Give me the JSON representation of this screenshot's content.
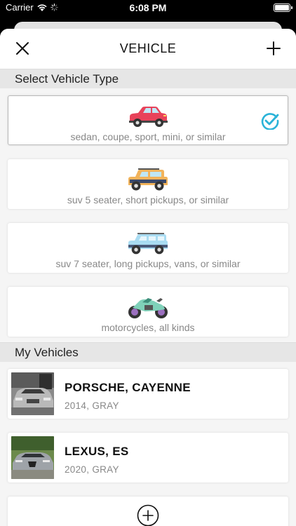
{
  "status": {
    "carrier": "Carrier",
    "time": "6:08 PM"
  },
  "nav": {
    "title": "VEHICLE",
    "close_icon": "close-icon",
    "add_icon": "plus-icon"
  },
  "select_type": {
    "header": "Select Vehicle Type",
    "types": [
      {
        "label": "sedan, coupe, sport, mini, or similar",
        "icon": "sedan-icon",
        "color": "#e8425a",
        "selected": true
      },
      {
        "label": "suv 5 seater, short pickups, or similar",
        "icon": "suv-5-seater-icon",
        "color": "#f2b35a",
        "selected": false
      },
      {
        "label": "suv 7 seater, long pickups, vans, or similar",
        "icon": "suv-7-seater-icon",
        "color": "#a9dcf2",
        "selected": false
      },
      {
        "label": "motorcycles, all kinds",
        "icon": "motorcycle-icon",
        "color": "#7fd1b9",
        "selected": false
      }
    ]
  },
  "my_vehicles": {
    "header": "My Vehicles",
    "items": [
      {
        "name": "PORSCHE, CAYENNE",
        "info": "2014, GRAY",
        "thumb": "porsche-photo"
      },
      {
        "name": "LEXUS, ES",
        "info": "2020, GRAY",
        "thumb": "lexus-photo"
      }
    ],
    "add_icon": "add-circle-icon"
  },
  "colors": {
    "accent": "#2bb3d8",
    "section_bg": "#e6e6e6"
  }
}
